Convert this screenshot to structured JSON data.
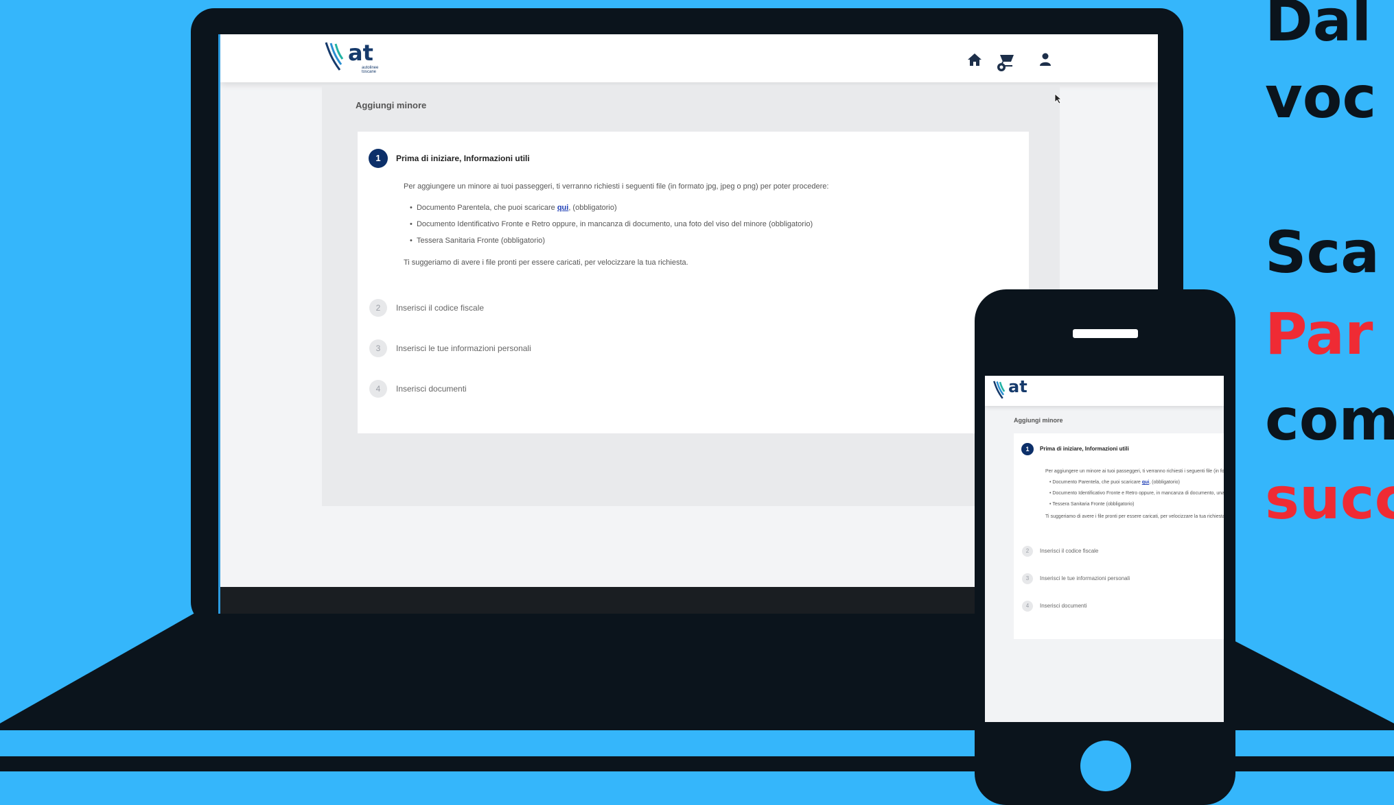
{
  "website": {
    "logo_text": "at",
    "logo_subtext": "autolinee toscane",
    "icons": [
      "home-icon",
      "cart-icon",
      "user-icon"
    ],
    "breadcrumb": "Aggiungi minore",
    "steps": [
      {
        "number": "1",
        "title": "Prima di iniziare, Informazioni utili"
      },
      {
        "number": "2",
        "title": "Inserisci il codice fiscale"
      },
      {
        "number": "3",
        "title": "Inserisci le tue informazioni personali"
      },
      {
        "number": "4",
        "title": "Inserisci documenti"
      }
    ],
    "intro": "Per aggiungere un minore ai tuoi passeggeri, ti verranno richiesti i seguenti file (in formato jpg, jpeg o png) per poter procedere:",
    "bullet1_before": "Documento Parentela, che puoi scaricare ",
    "bullet1_link": "qui",
    "bullet1_after": ", (obbligatorio)",
    "bullet2": "Documento Identificativo Fronte e Retro oppure, in mancanza di documento, una foto del viso del minore (obbligatorio)",
    "bullet3": "Tessera Sanitaria Fronte (obbligatorio)",
    "suggestion": "Ti suggeriamo di avere i file pronti per essere caricati, per velocizzare la tua richiesta."
  },
  "caption": {
    "line1": "Dal",
    "line2": "voc",
    "line3": "Sca",
    "line4": "Par",
    "line5": "com",
    "line6": "succ"
  },
  "colors": {
    "background": "#35b6fb",
    "device": "#0b141c",
    "accent_red": "#ef2b34",
    "step_active": "#0c2f69"
  }
}
